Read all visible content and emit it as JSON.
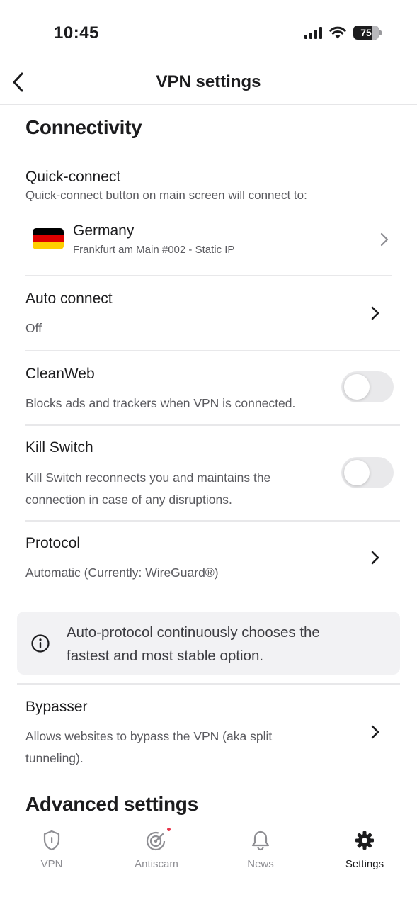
{
  "status_bar": {
    "time": "10:45",
    "battery": "75"
  },
  "header": {
    "title": "VPN settings"
  },
  "connectivity": {
    "section_title": "Connectivity",
    "quick_connect": {
      "title": "Quick-connect",
      "subtitle": "Quick-connect button on main screen will connect to:",
      "country": "Germany",
      "server": "Frankfurt am Main #002 - Static IP",
      "flag_colors": [
        "#000000",
        "#dd0000",
        "#ffce00"
      ]
    },
    "auto_connect": {
      "title": "Auto connect",
      "value": "Off"
    },
    "cleanweb": {
      "title": "CleanWeb",
      "subtitle": "Blocks ads and trackers when VPN is connected.",
      "enabled": false
    },
    "kill_switch": {
      "title": "Kill Switch",
      "subtitle_line1": "Kill Switch reconnects you and maintains the",
      "subtitle_line2": "connection in case of any disruptions.",
      "enabled": false
    },
    "protocol": {
      "title": "Protocol",
      "value": "Automatic (Currently: WireGuard®)"
    },
    "info": {
      "line1": "Auto-protocol continuously chooses the",
      "line2": "fastest and most stable option."
    },
    "bypasser": {
      "title": "Bypasser",
      "subtitle_line1": "Allows websites to bypass the VPN (aka split",
      "subtitle_line2": "tunneling)."
    }
  },
  "advanced": {
    "section_title": "Advanced settings"
  },
  "tabbar": {
    "tabs": [
      {
        "label": "VPN",
        "icon": "shield-icon",
        "active": false
      },
      {
        "label": "Antiscam",
        "icon": "radar-icon",
        "active": false,
        "badge": true
      },
      {
        "label": "News",
        "icon": "bell-icon",
        "active": false
      },
      {
        "label": "Settings",
        "icon": "gear-icon",
        "active": true
      }
    ]
  },
  "colors": {
    "text": "#1c1c1e",
    "secondary_text": "#5a5a5f",
    "toggle_off": "#e9e9eb",
    "info_bg": "#f2f2f4",
    "badge": "#e8344a"
  }
}
